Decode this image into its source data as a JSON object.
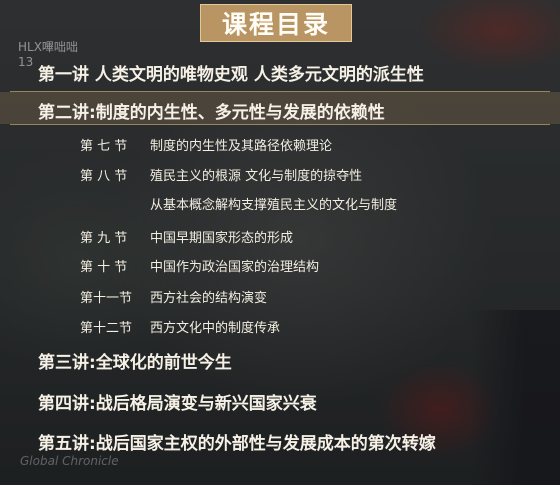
{
  "header": {
    "title": "课程目录"
  },
  "watermark": {
    "line1": "HLX嗶咄咄",
    "line2": "13",
    "bottom": "Global Chronicle"
  },
  "lectures": [
    {
      "label": "第一讲 人类文明的唯物史观 人类多元文明的派生性"
    },
    {
      "label": "第二讲:制度的内生性、多元性与发展的依赖性"
    },
    {
      "label": "第三讲:全球化的前世今生"
    },
    {
      "label": "第四讲:战后格局演变与新兴国家兴衰"
    },
    {
      "label": "第五讲:战后国家主权的外部性与发展成本的第次转嫁"
    }
  ],
  "sections": [
    {
      "num": "第 七 节",
      "title": "制度的内生性及其路径依赖理论"
    },
    {
      "num": "第 八 节",
      "title": "殖民主义的根源 文化与制度的掠夺性"
    },
    {
      "num": "",
      "title": "从基本概念解构支撑殖民主义的文化与制度"
    },
    {
      "num": "第 九 节",
      "title": "中国早期国家形态的形成"
    },
    {
      "num": "第 十 节",
      "title": "中国作为政治国家的治理结构"
    },
    {
      "num": "第十一节",
      "title": "西方社会的结构演变"
    },
    {
      "num": "第十二节",
      "title": "西方文化中的制度传承"
    }
  ]
}
